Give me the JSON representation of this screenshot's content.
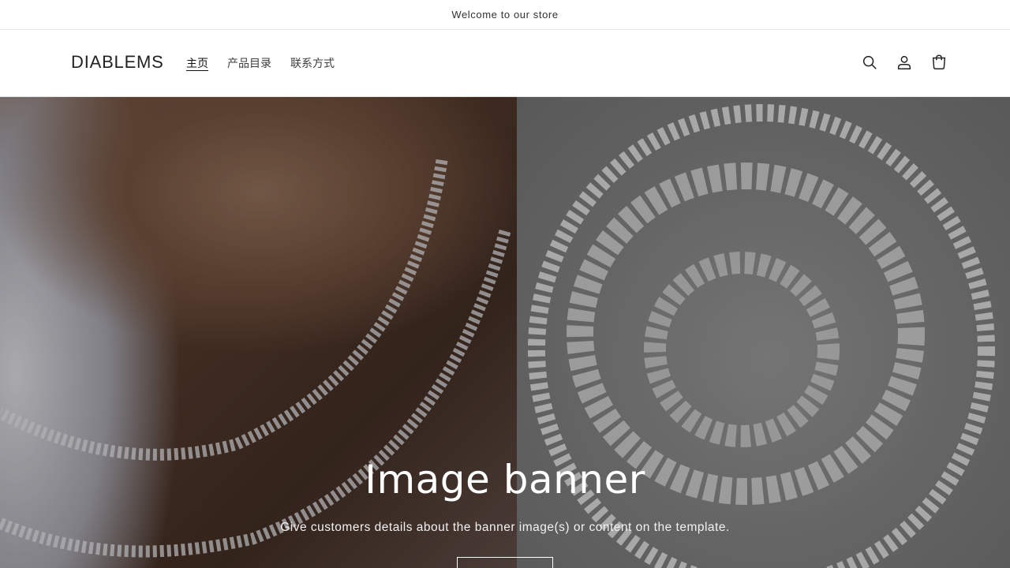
{
  "announcement": {
    "text": "Welcome to our store"
  },
  "header": {
    "logo": "DIABLEMS",
    "nav": [
      {
        "label": "主页",
        "active": true
      },
      {
        "label": "产品目录",
        "active": false
      },
      {
        "label": "联系方式",
        "active": false
      }
    ],
    "icons": [
      "search-icon",
      "account-icon",
      "cart-icon"
    ]
  },
  "banner": {
    "heading": "Image banner",
    "text": "Give customers details about the banner image(s) or content on the template."
  },
  "colors": {
    "text": "#121212",
    "border": "#e6e6e6",
    "banner_text": "#ffffff"
  }
}
